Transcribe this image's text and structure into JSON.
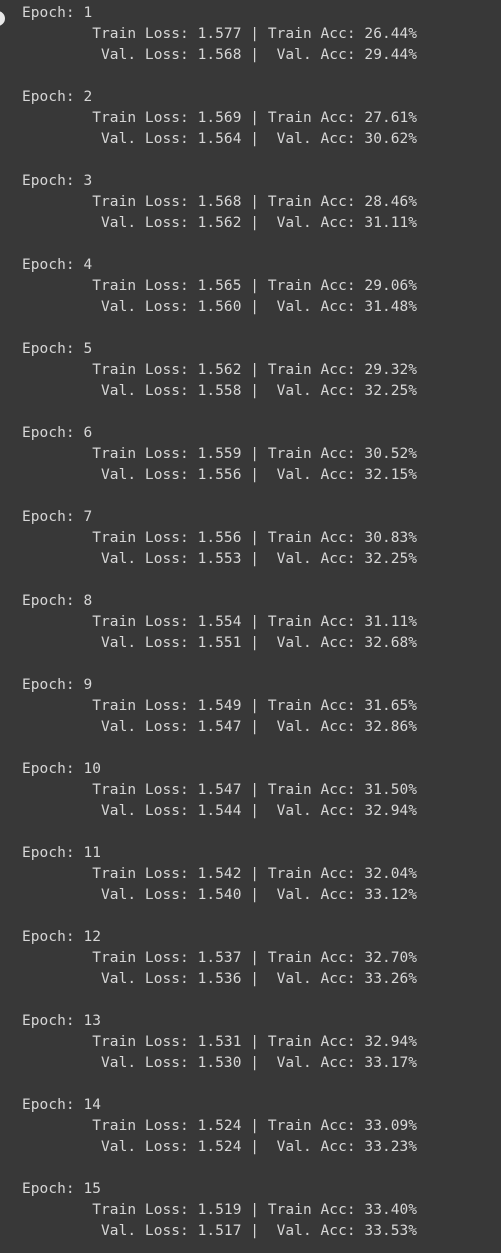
{
  "log": {
    "epochs": [
      {
        "epoch_line": "Epoch: 1",
        "train_line": "        Train Loss: 1.577 | Train Acc: 26.44%",
        "val_line": "         Val. Loss: 1.568 |  Val. Acc: 29.44%"
      },
      {
        "epoch_line": "Epoch: 2",
        "train_line": "        Train Loss: 1.569 | Train Acc: 27.61%",
        "val_line": "         Val. Loss: 1.564 |  Val. Acc: 30.62%"
      },
      {
        "epoch_line": "Epoch: 3",
        "train_line": "        Train Loss: 1.568 | Train Acc: 28.46%",
        "val_line": "         Val. Loss: 1.562 |  Val. Acc: 31.11%"
      },
      {
        "epoch_line": "Epoch: 4",
        "train_line": "        Train Loss: 1.565 | Train Acc: 29.06%",
        "val_line": "         Val. Loss: 1.560 |  Val. Acc: 31.48%"
      },
      {
        "epoch_line": "Epoch: 5",
        "train_line": "        Train Loss: 1.562 | Train Acc: 29.32%",
        "val_line": "         Val. Loss: 1.558 |  Val. Acc: 32.25%"
      },
      {
        "epoch_line": "Epoch: 6",
        "train_line": "        Train Loss: 1.559 | Train Acc: 30.52%",
        "val_line": "         Val. Loss: 1.556 |  Val. Acc: 32.15%"
      },
      {
        "epoch_line": "Epoch: 7",
        "train_line": "        Train Loss: 1.556 | Train Acc: 30.83%",
        "val_line": "         Val. Loss: 1.553 |  Val. Acc: 32.25%"
      },
      {
        "epoch_line": "Epoch: 8",
        "train_line": "        Train Loss: 1.554 | Train Acc: 31.11%",
        "val_line": "         Val. Loss: 1.551 |  Val. Acc: 32.68%"
      },
      {
        "epoch_line": "Epoch: 9",
        "train_line": "        Train Loss: 1.549 | Train Acc: 31.65%",
        "val_line": "         Val. Loss: 1.547 |  Val. Acc: 32.86%"
      },
      {
        "epoch_line": "Epoch: 10",
        "train_line": "        Train Loss: 1.547 | Train Acc: 31.50%",
        "val_line": "         Val. Loss: 1.544 |  Val. Acc: 32.94%"
      },
      {
        "epoch_line": "Epoch: 11",
        "train_line": "        Train Loss: 1.542 | Train Acc: 32.04%",
        "val_line": "         Val. Loss: 1.540 |  Val. Acc: 33.12%"
      },
      {
        "epoch_line": "Epoch: 12",
        "train_line": "        Train Loss: 1.537 | Train Acc: 32.70%",
        "val_line": "         Val. Loss: 1.536 |  Val. Acc: 33.26%"
      },
      {
        "epoch_line": "Epoch: 13",
        "train_line": "        Train Loss: 1.531 | Train Acc: 32.94%",
        "val_line": "         Val. Loss: 1.530 |  Val. Acc: 33.17%"
      },
      {
        "epoch_line": "Epoch: 14",
        "train_line": "        Train Loss: 1.524 | Train Acc: 33.09%",
        "val_line": "         Val. Loss: 1.524 |  Val. Acc: 33.23%"
      },
      {
        "epoch_line": "Epoch: 15",
        "train_line": "        Train Loss: 1.519 | Train Acc: 33.40%",
        "val_line": "         Val. Loss: 1.517 |  Val. Acc: 33.53%"
      }
    ]
  }
}
